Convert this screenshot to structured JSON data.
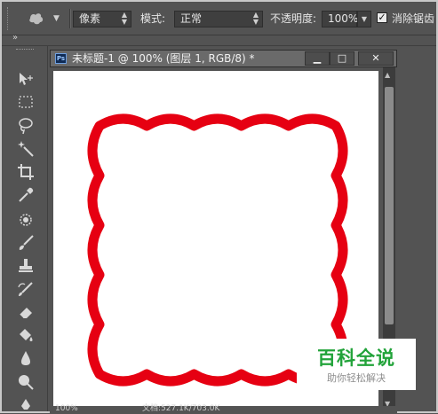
{
  "options_bar": {
    "tool_preset_icon": "tool-preset-icon",
    "mode_select_value": "像素",
    "blend_label": "模式:",
    "blend_value": "正常",
    "opacity_label": "不透明度:",
    "opacity_value": "100%",
    "antialias_checked": true,
    "antialias_label": "消除锯齿"
  },
  "toolbar": {
    "tools": [
      {
        "name": "move-tool-icon"
      },
      {
        "name": "marquee-tool-icon"
      },
      {
        "name": "lasso-tool-icon"
      },
      {
        "name": "magic-wand-tool-icon"
      },
      {
        "name": "crop-tool-icon"
      },
      {
        "name": "eyedropper-tool-icon"
      },
      {
        "name": "healing-brush-tool-icon"
      },
      {
        "name": "brush-tool-icon"
      },
      {
        "name": "clone-stamp-tool-icon"
      },
      {
        "name": "history-brush-tool-icon"
      },
      {
        "name": "eraser-tool-icon"
      },
      {
        "name": "paint-bucket-tool-icon"
      },
      {
        "name": "blur-tool-icon"
      },
      {
        "name": "dodge-tool-icon"
      },
      {
        "name": "pen-tool-icon"
      }
    ]
  },
  "document": {
    "badge": "Ps",
    "title": "未标题-1 @ 100% (图层 1, RGB/8) *",
    "minimize_label": "▁",
    "maximize_label": "□",
    "close_label": "✕",
    "shape_stroke_color": "#e60012"
  },
  "status_bar": {
    "zoom": "100%",
    "doc_info": "文档:527.1K/703.0K"
  },
  "watermark": {
    "title": "百科全说",
    "subtitle": "助你轻松解决"
  }
}
